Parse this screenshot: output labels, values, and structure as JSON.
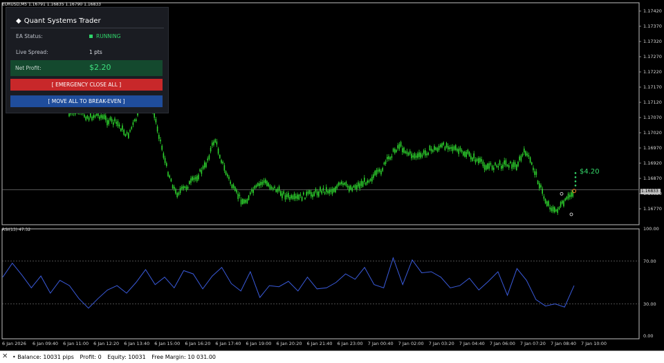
{
  "chart": {
    "symbol_header": "EURUSD,M5  1.16791 1.16835 1.16790 1.16833",
    "rsi_header": "RSI(13) 47.32",
    "current_price_tag": "1.16833",
    "profit_tag": "$4.20",
    "colors": {
      "candle": "#2ed52e",
      "rsi": "#3a5bdc",
      "grid": "#bfbfbf",
      "profit": "#35d96a"
    }
  },
  "chart_data": [
    {
      "type": "line",
      "title": "",
      "price_axis_ticks": [
        "1.17420",
        "1.17370",
        "1.17320",
        "1.17270",
        "1.17220",
        "1.17170",
        "1.17120",
        "1.17070",
        "1.17020",
        "1.16970",
        "1.16920",
        "1.16870",
        "1.16820",
        "1.16770"
      ],
      "x_ticks": [
        "6 Jan 2026",
        "6 Jan 09:40",
        "6 Jan 11:00",
        "6 Jan 12:20",
        "6 Jan 13:40",
        "6 Jan 15:00",
        "6 Jan 16:20",
        "6 Jan 17:40",
        "6 Jan 19:00",
        "6 Jan 20:20",
        "6 Jan 21:40",
        "6 Jan 23:00",
        "7 Jan 00:40",
        "7 Jan 02:00",
        "7 Jan 03:20",
        "7 Jan 04:40",
        "7 Jan 06:00",
        "7 Jan 07:20",
        "7 Jan 08:40",
        "7 Jan 10:00"
      ],
      "series": [
        {
          "name": "",
          "values": [
            1.1708,
            1.1709,
            1.1707,
            1.1708,
            1.1706,
            1.1705,
            1.1701,
            1.1707,
            1.1717,
            1.1705,
            1.1691,
            1.1682,
            1.1684,
            1.1687,
            1.1691,
            1.17,
            1.169,
            1.1683,
            1.1679,
            1.1683,
            1.1686,
            1.1684,
            1.1682,
            1.168,
            1.1681,
            1.1682,
            1.1683,
            1.1683,
            1.1685,
            1.1684,
            1.1685,
            1.1687,
            1.1689,
            1.1694,
            1.1698,
            1.1695,
            1.1694,
            1.1696,
            1.1697,
            1.1698,
            1.1696,
            1.1695,
            1.1693,
            1.1691,
            1.1691,
            1.1692,
            1.1691,
            1.1696,
            1.1689,
            1.168,
            1.1676,
            1.1679,
            1.1683
          ]
        }
      ]
    },
    {
      "type": "line",
      "title": "RSI(13) 47.32",
      "ylim": [
        0,
        100
      ],
      "y_ticks": [
        "100.00",
        "70.00",
        "30.00",
        "0.00"
      ],
      "levels": [
        70,
        30
      ],
      "series": [
        {
          "name": "RSI(13)",
          "values": [
            55,
            68,
            57,
            45,
            56,
            40,
            52,
            47,
            35,
            26,
            35,
            43,
            47,
            40,
            50,
            62,
            48,
            55,
            45,
            61,
            58,
            44,
            56,
            64,
            49,
            42,
            60,
            36,
            47,
            46,
            51,
            42,
            55,
            44,
            45,
            50,
            58,
            53,
            64,
            48,
            45,
            73,
            48,
            71,
            59,
            60,
            55,
            45,
            47,
            54,
            43,
            51,
            60,
            38,
            63,
            52,
            34,
            28,
            30,
            27,
            47
          ]
        }
      ]
    }
  ],
  "panel": {
    "title": "Quant Systems Trader",
    "title_icon": "diamond-icon",
    "ea_status_label": "EA Status:",
    "ea_status_value": "RUNNING",
    "spread_label": "Live Spread:",
    "spread_value": "1 pts",
    "profit_label": "Net Profit:",
    "profit_value": "$2.20",
    "close_all_label": "[ EMERGENCY CLOSE ALL ]",
    "breakeven_label": "[ MOVE ALL TO BREAK-EVEN ]",
    "colors": {
      "bg": "#1a1c22",
      "running": "#2fd46a",
      "profit_bg": "#14492e",
      "close_btn": "#c8282a",
      "breakeven_btn": "#1f4d9c"
    }
  },
  "statusbar": {
    "balance": "• Balance: 10031 pips",
    "profit": "Profit: 0",
    "equity": "Equity: 10031",
    "free_margin": "Free Margin: 10 031.00"
  }
}
